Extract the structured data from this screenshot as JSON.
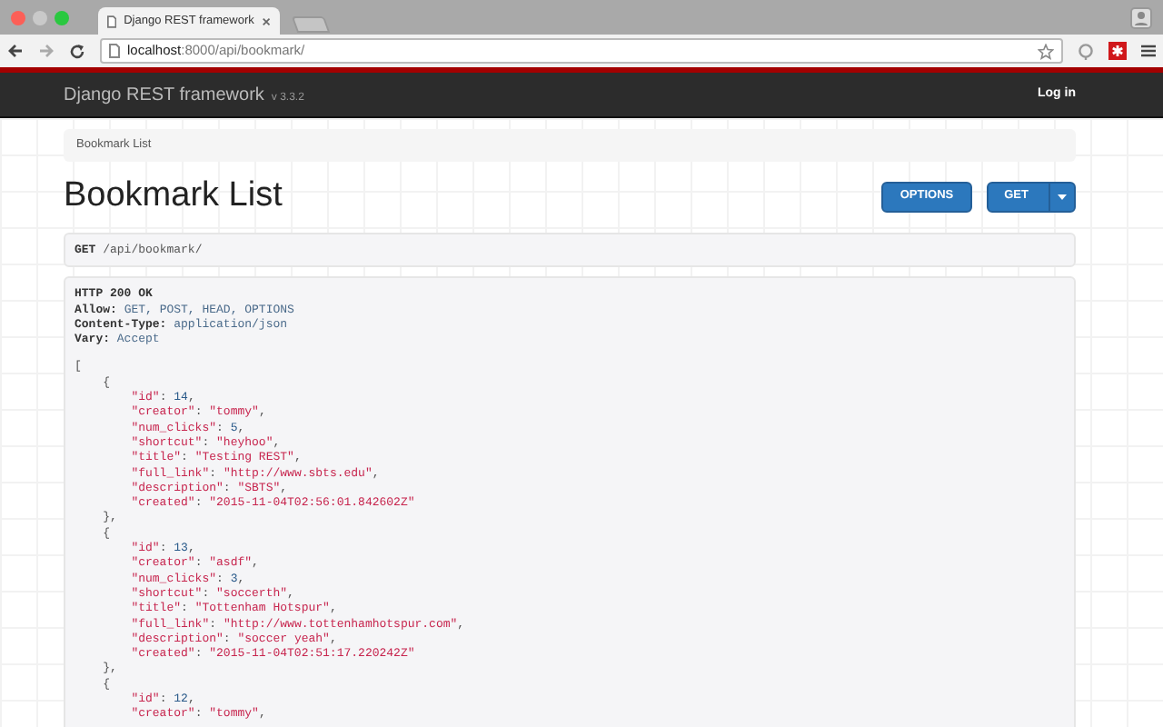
{
  "browser": {
    "tab_title": "Django REST framework",
    "url_host": "localhost",
    "url_path": ":8000/api/bookmark/"
  },
  "navbar": {
    "brand": "Django REST framework",
    "version": "v 3.3.2",
    "login": "Log in"
  },
  "breadcrumb": [
    "Bookmark List"
  ],
  "page_title": "Bookmark List",
  "buttons": [
    {
      "label": "OPTIONS",
      "dropdown": false
    },
    {
      "label": "GET",
      "dropdown": true
    }
  ],
  "request": {
    "method": "GET",
    "path": "/api/bookmark/"
  },
  "response": {
    "status": "HTTP 200 OK",
    "headers": [
      {
        "name": "Allow:",
        "value": "GET, POST, HEAD, OPTIONS"
      },
      {
        "name": "Content-Type:",
        "value": "application/json"
      },
      {
        "name": "Vary:",
        "value": "Accept"
      }
    ],
    "lines": [
      [
        {
          "kind": "punct",
          "text": "["
        }
      ],
      [
        {
          "kind": "punct",
          "text": "    {"
        }
      ],
      [
        {
          "kind": "key",
          "text": "        \"id\""
        },
        {
          "kind": "punct",
          "text": ": "
        },
        {
          "kind": "num",
          "text": "14"
        },
        {
          "kind": "punct",
          "text": ","
        }
      ],
      [
        {
          "kind": "key",
          "text": "        \"creator\""
        },
        {
          "kind": "punct",
          "text": ": "
        },
        {
          "kind": "str",
          "text": "\"tommy\""
        },
        {
          "kind": "punct",
          "text": ","
        }
      ],
      [
        {
          "kind": "key",
          "text": "        \"num_clicks\""
        },
        {
          "kind": "punct",
          "text": ": "
        },
        {
          "kind": "num",
          "text": "5"
        },
        {
          "kind": "punct",
          "text": ","
        }
      ],
      [
        {
          "kind": "key",
          "text": "        \"shortcut\""
        },
        {
          "kind": "punct",
          "text": ": "
        },
        {
          "kind": "str",
          "text": "\"heyhoo\""
        },
        {
          "kind": "punct",
          "text": ","
        }
      ],
      [
        {
          "kind": "key",
          "text": "        \"title\""
        },
        {
          "kind": "punct",
          "text": ": "
        },
        {
          "kind": "str",
          "text": "\"Testing REST\""
        },
        {
          "kind": "punct",
          "text": ","
        }
      ],
      [
        {
          "kind": "key",
          "text": "        \"full_link\""
        },
        {
          "kind": "punct",
          "text": ": "
        },
        {
          "kind": "str",
          "text": "\"http://www.sbts.edu\""
        },
        {
          "kind": "punct",
          "text": ","
        }
      ],
      [
        {
          "kind": "key",
          "text": "        \"description\""
        },
        {
          "kind": "punct",
          "text": ": "
        },
        {
          "kind": "str",
          "text": "\"SBTS\""
        },
        {
          "kind": "punct",
          "text": ","
        }
      ],
      [
        {
          "kind": "key",
          "text": "        \"created\""
        },
        {
          "kind": "punct",
          "text": ": "
        },
        {
          "kind": "str",
          "text": "\"2015-11-04T02:56:01.842602Z\""
        }
      ],
      [
        {
          "kind": "punct",
          "text": "    },"
        }
      ],
      [
        {
          "kind": "punct",
          "text": "    {"
        }
      ],
      [
        {
          "kind": "key",
          "text": "        \"id\""
        },
        {
          "kind": "punct",
          "text": ": "
        },
        {
          "kind": "num",
          "text": "13"
        },
        {
          "kind": "punct",
          "text": ","
        }
      ],
      [
        {
          "kind": "key",
          "text": "        \"creator\""
        },
        {
          "kind": "punct",
          "text": ": "
        },
        {
          "kind": "str",
          "text": "\"asdf\""
        },
        {
          "kind": "punct",
          "text": ","
        }
      ],
      [
        {
          "kind": "key",
          "text": "        \"num_clicks\""
        },
        {
          "kind": "punct",
          "text": ": "
        },
        {
          "kind": "num",
          "text": "3"
        },
        {
          "kind": "punct",
          "text": ","
        }
      ],
      [
        {
          "kind": "key",
          "text": "        \"shortcut\""
        },
        {
          "kind": "punct",
          "text": ": "
        },
        {
          "kind": "str",
          "text": "\"soccerth\""
        },
        {
          "kind": "punct",
          "text": ","
        }
      ],
      [
        {
          "kind": "key",
          "text": "        \"title\""
        },
        {
          "kind": "punct",
          "text": ": "
        },
        {
          "kind": "str",
          "text": "\"Tottenham Hotspur\""
        },
        {
          "kind": "punct",
          "text": ","
        }
      ],
      [
        {
          "kind": "key",
          "text": "        \"full_link\""
        },
        {
          "kind": "punct",
          "text": ": "
        },
        {
          "kind": "str",
          "text": "\"http://www.tottenhamhotspur.com\""
        },
        {
          "kind": "punct",
          "text": ","
        }
      ],
      [
        {
          "kind": "key",
          "text": "        \"description\""
        },
        {
          "kind": "punct",
          "text": ": "
        },
        {
          "kind": "str",
          "text": "\"soccer yeah\""
        },
        {
          "kind": "punct",
          "text": ","
        }
      ],
      [
        {
          "kind": "key",
          "text": "        \"created\""
        },
        {
          "kind": "punct",
          "text": ": "
        },
        {
          "kind": "str",
          "text": "\"2015-11-04T02:51:17.220242Z\""
        }
      ],
      [
        {
          "kind": "punct",
          "text": "    },"
        }
      ],
      [
        {
          "kind": "punct",
          "text": "    {"
        }
      ],
      [
        {
          "kind": "key",
          "text": "        \"id\""
        },
        {
          "kind": "punct",
          "text": ": "
        },
        {
          "kind": "num",
          "text": "12"
        },
        {
          "kind": "punct",
          "text": ","
        }
      ],
      [
        {
          "kind": "key",
          "text": "        \"creator\""
        },
        {
          "kind": "punct",
          "text": ": "
        },
        {
          "kind": "str",
          "text": "\"tommy\""
        },
        {
          "kind": "punct",
          "text": ","
        }
      ]
    ]
  }
}
